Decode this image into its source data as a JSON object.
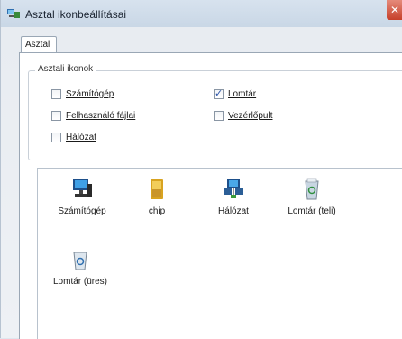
{
  "window": {
    "title": "Asztal ikonbeállításai"
  },
  "tabs": [
    {
      "label": "Asztal"
    }
  ],
  "group": {
    "label": "Asztali ikonok",
    "checkboxes": [
      {
        "label": "Számítógép",
        "checked": false
      },
      {
        "label": "Lomtár",
        "checked": true
      },
      {
        "label": "Felhasználó fájlai",
        "checked": false
      },
      {
        "label": "Vezérlőpult",
        "checked": false
      },
      {
        "label": "Hálózat",
        "checked": false
      }
    ]
  },
  "icons": [
    {
      "label": "Számítógép",
      "icon": "computer-icon"
    },
    {
      "label": "chip",
      "icon": "user-folder-icon"
    },
    {
      "label": "Hálózat",
      "icon": "network-icon"
    },
    {
      "label": "Lomtár (teli)",
      "icon": "recycle-bin-full-icon"
    },
    {
      "label": "Lomtár (üres)",
      "icon": "recycle-bin-empty-icon"
    }
  ],
  "colors": {
    "close": "#c6402a",
    "accent": "#2b54a8"
  }
}
